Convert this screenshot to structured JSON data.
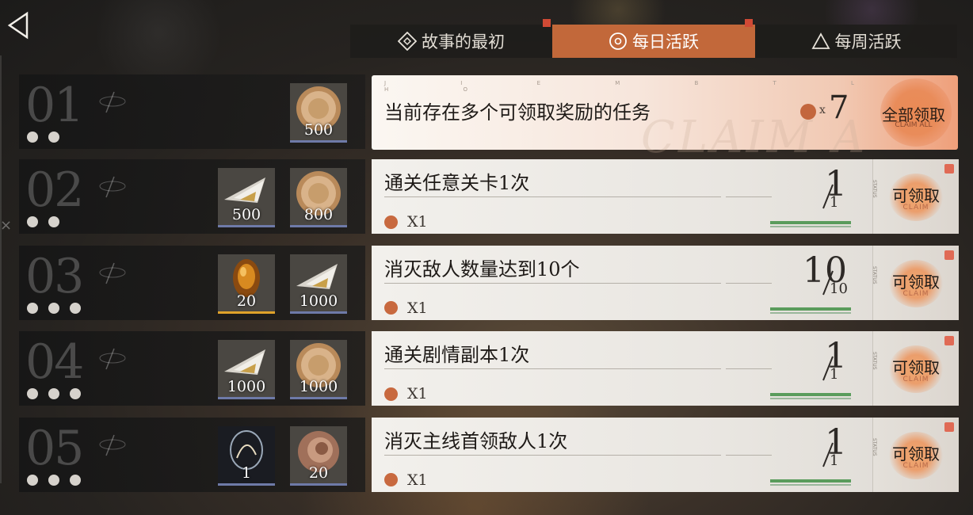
{
  "tabs": [
    {
      "label": "故事的最初",
      "icon": "diamond-target-icon",
      "active": false
    },
    {
      "label": "每日活跃",
      "icon": "circle-target-icon",
      "active": true
    },
    {
      "label": "每周活跃",
      "icon": "triangle-icon",
      "active": false
    }
  ],
  "summary": {
    "text": "当前存在多个可领取奖励的任务",
    "count_prefix": "x",
    "count": "7",
    "claim_all_label": "全部领取",
    "claim_all_sub": "CLAIM ALL",
    "watermark": "CLAIM A",
    "reward_icons": [
      {
        "icon": "coin-icon",
        "qty": "500"
      }
    ]
  },
  "rows": [
    {
      "num": "02",
      "task": "通关任意关卡1次",
      "reward": "X1",
      "progress_num": "1",
      "progress_den": "1",
      "claim_label": "可领取",
      "claim_sub": "CLAIM",
      "rewards": [
        {
          "icon": "crystal-shard-icon",
          "qty": "500"
        },
        {
          "icon": "coin-icon",
          "qty": "800"
        }
      ]
    },
    {
      "num": "03",
      "task": "消灭敌人数量达到10个",
      "reward": "X1",
      "progress_num": "10",
      "progress_den": "10",
      "claim_label": "可领取",
      "claim_sub": "CLAIM",
      "rewards": [
        {
          "icon": "amber-gem-icon",
          "qty": "20"
        },
        {
          "icon": "crystal-shard-icon",
          "qty": "1000"
        }
      ]
    },
    {
      "num": "04",
      "task": "通关剧情副本1次",
      "reward": "X1",
      "progress_num": "1",
      "progress_den": "1",
      "claim_label": "可领取",
      "claim_sub": "CLAIM",
      "rewards": [
        {
          "icon": "crystal-shard-icon",
          "qty": "1000"
        },
        {
          "icon": "coin-icon",
          "qty": "1000"
        }
      ]
    },
    {
      "num": "05",
      "task": "消灭主线首领敌人1次",
      "reward": "X1",
      "progress_num": "1",
      "progress_den": "1",
      "claim_label": "可领取",
      "claim_sub": "CLAIM",
      "rewards": [
        {
          "icon": "glass-orb-icon",
          "qty": "1"
        },
        {
          "icon": "ammonite-shell-icon",
          "qty": "20"
        }
      ]
    }
  ],
  "first_num": "01",
  "colors": {
    "accent": "#c2683a",
    "badge": "#e06a55",
    "progress": "#5a9c5c"
  }
}
